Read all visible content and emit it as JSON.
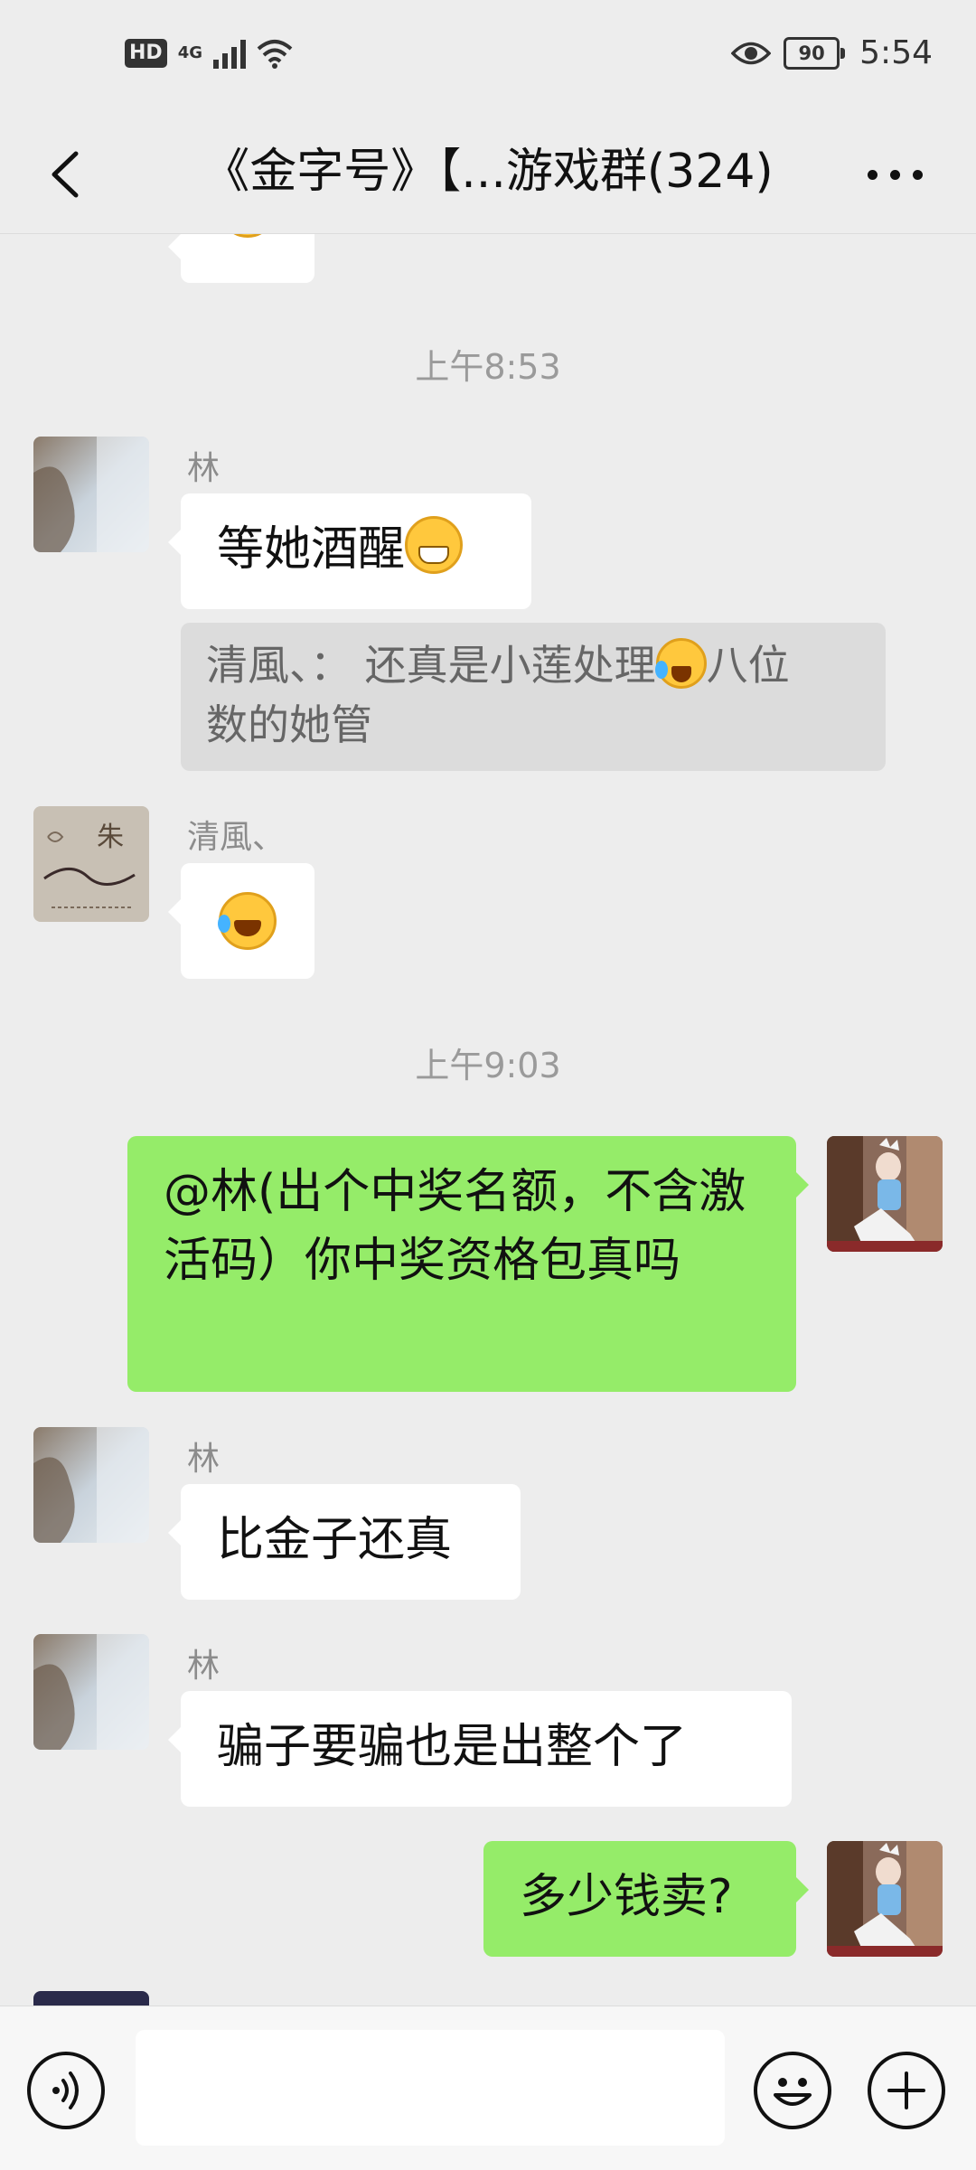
{
  "status_bar": {
    "hd": "HD",
    "network": "4G",
    "battery": "90",
    "time": "5:54"
  },
  "header": {
    "title": "《金字号》【...游戏群(324)"
  },
  "messages": {
    "time1": "上午8:53",
    "lin_name_1": "林",
    "lin_msg_1": "等她酒醒",
    "quote_text_1": "清風、：  还真是小莲处理",
    "quote_text_2": "八位",
    "quote_text_3": "数的她管",
    "qingfeng_name": "清風、",
    "time2": "上午9:03",
    "my_msg_1": "@林(出个中奖名额，不含激活码）你中奖资格包真吗",
    "lin_name_2": "林",
    "lin_msg_2": "比金子还真",
    "lin_name_3": "林",
    "lin_msg_3": "骗子要骗也是出整个了",
    "my_msg_2": "多少钱卖?"
  },
  "icons": {
    "back": "chevron-left-icon",
    "more": "more-dots-icon",
    "voice": "voice-icon",
    "emoji": "emoji-icon",
    "plus": "plus-icon"
  },
  "colors": {
    "background": "#ededed",
    "outgoing_bubble": "#95ec69",
    "incoming_bubble": "#ffffff",
    "quote_bg": "#dcdcdc"
  }
}
